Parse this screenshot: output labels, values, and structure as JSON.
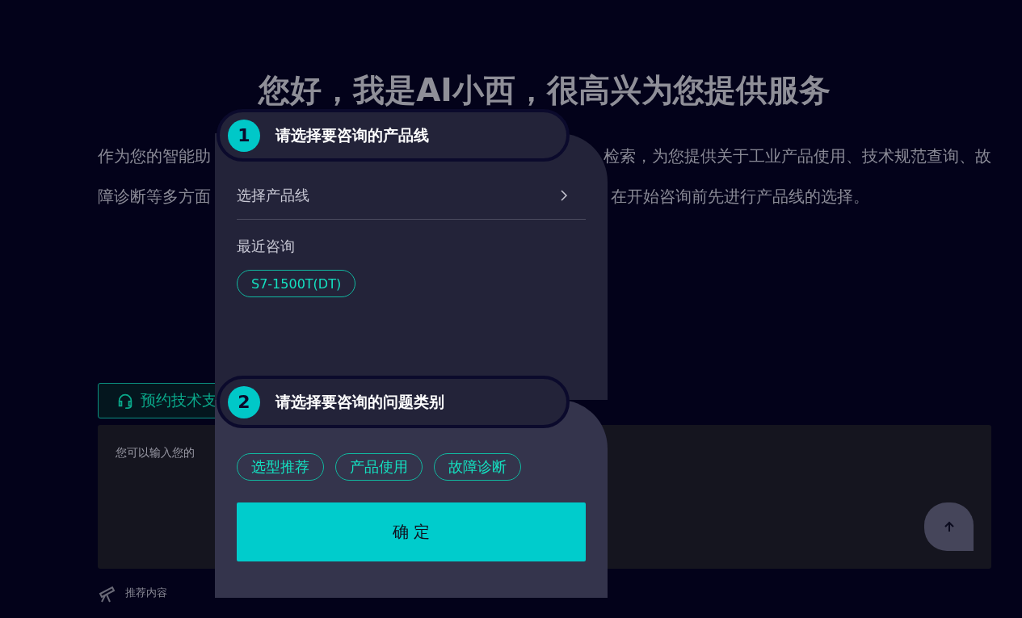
{
  "heading": "您好，我是AI小西，很高兴为您提供服务",
  "intro_lines": [
    {
      "left": "作为您的智能助",
      "right": "检索，为您提供关于工业产品使用、技术规范查询、故"
    },
    {
      "left": "障诊断等多方面",
      "right": "在开始咨询前先进行产品线的选择。"
    }
  ],
  "support_button": {
    "label": "预约技术支"
  },
  "question_box": {
    "placeholder": "您可以输入您的"
  },
  "recommended": {
    "label": "推荐内容"
  },
  "dialog": {
    "step_1": {
      "number": "1",
      "title": "请选择要咨询的产品线",
      "selector_label": "选择产品线",
      "recent_label": "最近咨询",
      "recent_tags": [
        "S7-1500T(DT)"
      ]
    },
    "step_2": {
      "number": "2",
      "title": "请选择要咨询的问题类别",
      "categories": [
        "选型推荐",
        "产品使用",
        "故障诊断"
      ]
    },
    "confirm_button": "确 定"
  }
}
